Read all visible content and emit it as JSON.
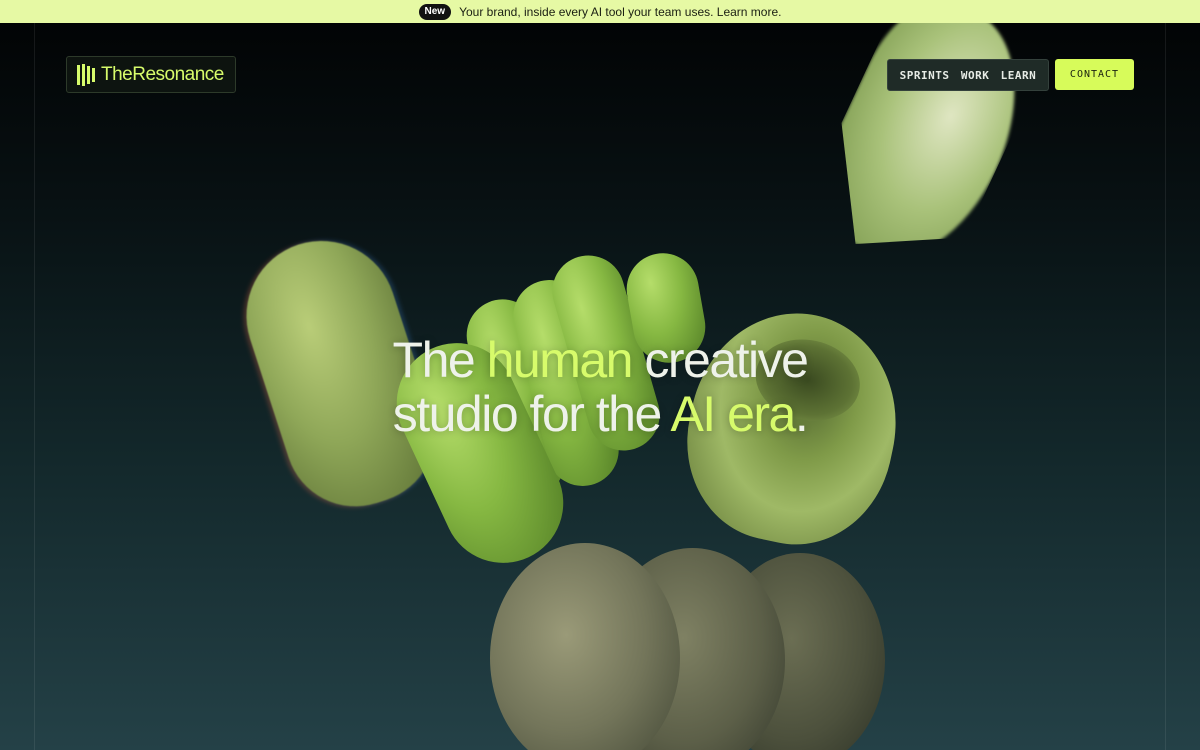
{
  "announcement": {
    "badge": "New",
    "text": "Your brand, inside every AI tool your team uses. Learn more."
  },
  "brand": {
    "name": "TheResonance"
  },
  "nav": {
    "items": [
      "SPRINTS",
      "WORK",
      "LEARN"
    ],
    "cta": "CONTACT"
  },
  "hero": {
    "line1_a": "The ",
    "line1_highlight": "human",
    "line1_b": " creative",
    "line2_a": "studio for the ",
    "line2_highlight": "AI era",
    "line2_b": "."
  },
  "colors": {
    "accent": "#d7fb6b",
    "announcement_bg": "#e6f9a4",
    "background": "#05080a",
    "text": "#eef2ea"
  }
}
